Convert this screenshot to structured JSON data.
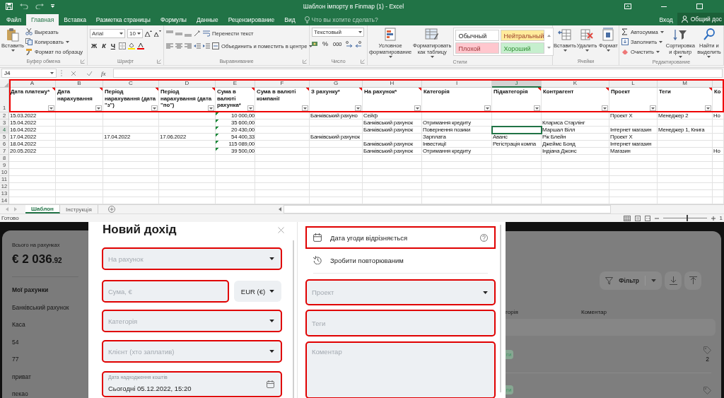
{
  "window": {
    "title": "Шаблон імпорту в Finmap (1) - Excel",
    "sign_in": "Вход",
    "share": "Общий дос"
  },
  "menu_tabs": [
    {
      "label": "Файл",
      "selected": false
    },
    {
      "label": "Главная",
      "selected": true
    },
    {
      "label": "Вставка",
      "selected": false
    },
    {
      "label": "Разметка страницы",
      "selected": false
    },
    {
      "label": "Формулы",
      "selected": false
    },
    {
      "label": "Данные",
      "selected": false
    },
    {
      "label": "Рецензирование",
      "selected": false
    },
    {
      "label": "Вид",
      "selected": false
    }
  ],
  "tell_me": "Что вы хотите сделать?",
  "ribbon": [
    {
      "kind": "clipboard",
      "label": "Буфер обмена",
      "big": [
        "Вставить"
      ],
      "small": [
        "Вырезать",
        "Копировать",
        "Формат по образцу"
      ]
    },
    {
      "kind": "font",
      "label": "Шрифт",
      "font": "Arial",
      "size": "10",
      "glyphs": [
        "Ж",
        "К",
        "Ч"
      ]
    },
    {
      "kind": "alignment",
      "label": "Выравнивание",
      "small": [
        "Перенести текст",
        "Объединить и поместить в центре"
      ]
    },
    {
      "kind": "number",
      "label": "Число",
      "format": "Текстовый",
      "glyphs": [
        "%",
        "000"
      ]
    },
    {
      "kind": "styles",
      "label": "Стили",
      "big": [
        "Условное форматирование",
        "Форматировать как таблицу"
      ],
      "swatches": [
        {
          "label": "Обычный",
          "color": "#ffffff"
        },
        {
          "label": "Нейтральный",
          "color": "#ffeb9c"
        },
        {
          "label": "Плохой",
          "color": "#ffc7ce"
        },
        {
          "label": "Хороший",
          "color": "#c6efce"
        }
      ]
    },
    {
      "kind": "cells",
      "label": "Ячейки",
      "big": [
        "Вставить",
        "Удалить",
        "Формат"
      ]
    },
    {
      "kind": "editing",
      "label": "Редактирование",
      "small": [
        "Автосумма",
        "Заполнить",
        "Очистить"
      ],
      "big": [
        "Сортировка и фильтр",
        "Найти и выделить"
      ]
    }
  ],
  "formula_bar": {
    "cell": "J4",
    "fx": "fx"
  },
  "sheet": {
    "header_highlighted": true,
    "header_row_number": "1",
    "columns": [
      {
        "letter": "A",
        "header": "Дата платежу*",
        "comment": true,
        "selected": false
      },
      {
        "letter": "B",
        "header": "Дата нарахування",
        "comment": true,
        "selected": false
      },
      {
        "letter": "C",
        "header": "Період нарахування (дата \"з\")",
        "comment": true,
        "selected": false
      },
      {
        "letter": "D",
        "header": "Період нарахування (дата \"по\")",
        "comment": true,
        "selected": false
      },
      {
        "letter": "E",
        "header": "Сума в валюті рахунка*",
        "comment": true,
        "selected": false
      },
      {
        "letter": "F",
        "header": "Сума в валюті компанії",
        "comment": true,
        "selected": false
      },
      {
        "letter": "G",
        "header": "З рахунку*",
        "comment": true,
        "selected": false
      },
      {
        "letter": "H",
        "header": "На рахунок*",
        "comment": true,
        "selected": false
      },
      {
        "letter": "I",
        "header": "Категорія",
        "comment": false,
        "selected": false
      },
      {
        "letter": "J",
        "header": "Підкатегорія",
        "comment": true,
        "selected": true
      },
      {
        "letter": "K",
        "header": "Контрагент",
        "comment": true,
        "selected": false
      },
      {
        "letter": "L",
        "header": "Проект",
        "comment": false,
        "selected": false
      },
      {
        "letter": "M",
        "header": "Теги",
        "comment": true,
        "selected": false
      },
      {
        "header": "Ко",
        "comment": false,
        "selected": false
      }
    ],
    "rows": [
      {
        "number": "2",
        "selected": false,
        "warning_mark": true,
        "cells": [
          "15.03.2022",
          null,
          null,
          null,
          "10 000,00",
          null,
          "Банківський рахуно",
          "Сейф",
          null,
          null,
          null,
          "Проект Х",
          "Менеджер 2",
          "Но"
        ]
      },
      {
        "number": "3",
        "selected": false,
        "warning_mark": true,
        "cells": [
          "15.04.2022",
          null,
          null,
          null,
          "35 600,00",
          null,
          null,
          "Банківський рахунок",
          "Отримання кредиту",
          null,
          "Клариса Старлінг",
          null,
          null,
          null
        ]
      },
      {
        "number": "4",
        "selected": true,
        "warning_mark": true,
        "cells": [
          "16.04.2022",
          null,
          null,
          null,
          "20 430,00",
          null,
          null,
          "Банківський рахунок",
          "Повернення позики",
          null,
          "Маршал Вілл",
          "Інтернет магазин",
          "Менеджер 1, Книга",
          null
        ]
      },
      {
        "number": "5",
        "selected": false,
        "warning_mark": true,
        "cells": [
          "17.04.2022",
          null,
          "17.04.2022",
          "17.06.2022",
          "54 400,33",
          null,
          "Банківський рахунок",
          null,
          "Зарплата",
          "Аванс",
          "Рік Блейн",
          "Проект Х",
          null,
          null
        ]
      },
      {
        "number": "6",
        "selected": false,
        "warning_mark": true,
        "cells": [
          "18.04.2022",
          null,
          null,
          null,
          "115 089,00",
          null,
          null,
          "Банківський рахунок",
          "Інвестиції",
          "Регістрація компа",
          "Джеймс Бонд",
          "Інтернет магазин",
          null,
          null
        ]
      },
      {
        "number": "7",
        "selected": false,
        "warning_mark": true,
        "cells": [
          "20.05.2022",
          null,
          null,
          null,
          "39 500,00",
          null,
          null,
          "Банківський рахунок",
          "Отримання кредиту",
          null,
          "Індіана Джонс",
          "Магазин",
          null,
          "Но"
        ]
      },
      {
        "number": "8",
        "selected": false
      },
      {
        "number": "9",
        "selected": false
      },
      {
        "number": "10",
        "selected": false
      },
      {
        "number": "11",
        "selected": false
      },
      {
        "number": "12",
        "selected": false
      },
      {
        "number": "13",
        "selected": false
      },
      {
        "number": "14",
        "selected": false
      }
    ]
  },
  "sheet_tabs": [
    {
      "label": "Шаблон",
      "selected": true
    },
    {
      "label": "Інструкція",
      "selected": false
    }
  ],
  "status_bar": {
    "text": "Готово",
    "zoom": {
      "level": 0.55
    },
    "zoom_text": "1"
  },
  "finmap": {
    "balance": {
      "label": "Всього на рахунках",
      "amount": "€ 2 036",
      "cents": ".92"
    },
    "accounts_title": "Мої рахунки",
    "accounts": [
      "Банківський рахунок",
      "Каса",
      "54",
      "77",
      "приват",
      "пекао"
    ],
    "filter": "Фільтр",
    "table": {
      "columns": [
        "горія",
        "Коментар"
      ],
      "rows": [
        {
          "tag": "ги",
          "tag_count": "2"
        },
        {
          "tag": "ги"
        }
      ]
    }
  },
  "dialog": {
    "title": "Новий дохід",
    "left_fields": [
      {
        "kind": "select",
        "placeholder": "На рахунок",
        "highlighted": true
      },
      {
        "kind": "amount",
        "placeholder": "Сума, €",
        "currency": "EUR (€)",
        "highlighted": true
      },
      {
        "kind": "select",
        "placeholder": "Категорія",
        "highlighted": true
      },
      {
        "kind": "select",
        "placeholder": "Клієнт (хто заплатив)",
        "highlighted": true
      },
      {
        "kind": "date",
        "label": "Дата надходження коштів",
        "value": "Сьогодні 05.12.2022, 15:20",
        "highlighted": true
      }
    ],
    "options": [
      {
        "kind": "date",
        "label": "Дата угоди відрізняється",
        "highlighted": true
      },
      {
        "kind": "repeat",
        "label": "Зробити повторюваним",
        "highlighted": false
      }
    ],
    "right_fields": [
      {
        "kind": "select",
        "placeholder": "Проект",
        "highlighted": true
      },
      {
        "kind": "input",
        "placeholder": "Теги",
        "highlighted": true
      },
      {
        "kind": "textarea",
        "placeholder": "Коментар",
        "highlighted": true
      }
    ]
  }
}
